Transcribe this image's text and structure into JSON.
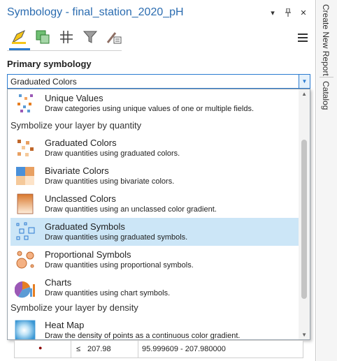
{
  "header": {
    "title": "Symbology - final_station_2020_pH"
  },
  "title_controls": {
    "menu_arrow": "▾",
    "pin": "📌",
    "close": "✕"
  },
  "toolbar": {
    "tabs": [
      {
        "icon": "primary-symbology-icon"
      },
      {
        "icon": "vary-symbology-icon"
      },
      {
        "icon": "label-classes-icon"
      },
      {
        "icon": "filter-icon"
      },
      {
        "icon": "symbol-layer-drawing-icon"
      }
    ],
    "menu_icon": "hamburger-icon"
  },
  "primary_symbology": {
    "label": "Primary symbology",
    "selected_value": "Graduated Colors"
  },
  "dropdown": {
    "items": [
      {
        "name": "Unique Values",
        "desc": "Draw categories using unique values of one or multiple fields.",
        "icon": "unique-values-icon"
      },
      {
        "header": "Symbolize your layer by quantity"
      },
      {
        "name": "Graduated Colors",
        "desc": "Draw quantities using graduated colors.",
        "icon": "graduated-colors-icon"
      },
      {
        "name": "Bivariate Colors",
        "desc": "Draw quantities using bivariate colors.",
        "icon": "bivariate-colors-icon"
      },
      {
        "name": "Unclassed Colors",
        "desc": "Draw quantities using an unclassed color gradient.",
        "icon": "unclassed-colors-icon"
      },
      {
        "name": "Graduated Symbols",
        "desc": "Draw quantities using graduated symbols.",
        "icon": "graduated-symbols-icon",
        "selected": true
      },
      {
        "name": "Proportional Symbols",
        "desc": "Draw quantities using proportional symbols.",
        "icon": "proportional-symbols-icon"
      },
      {
        "name": "Charts",
        "desc": "Draw quantities using chart symbols.",
        "icon": "charts-icon"
      },
      {
        "header": "Symbolize your layer by density"
      },
      {
        "name": "Heat Map",
        "desc": "Draw the density of points as a continuous color gradient.",
        "icon": "heat-map-icon"
      }
    ]
  },
  "class_table": {
    "row": {
      "symbol": "●",
      "op": "≤",
      "value": "207.98",
      "label": "95.999609 - 207.980000"
    }
  },
  "side_tabs": [
    {
      "label": "Create New Report"
    },
    {
      "label": "Catalog"
    }
  ],
  "colors": {
    "accent": "#2b7bd0",
    "title": "#2b6cb0",
    "selected_row": "#cce6f7"
  }
}
